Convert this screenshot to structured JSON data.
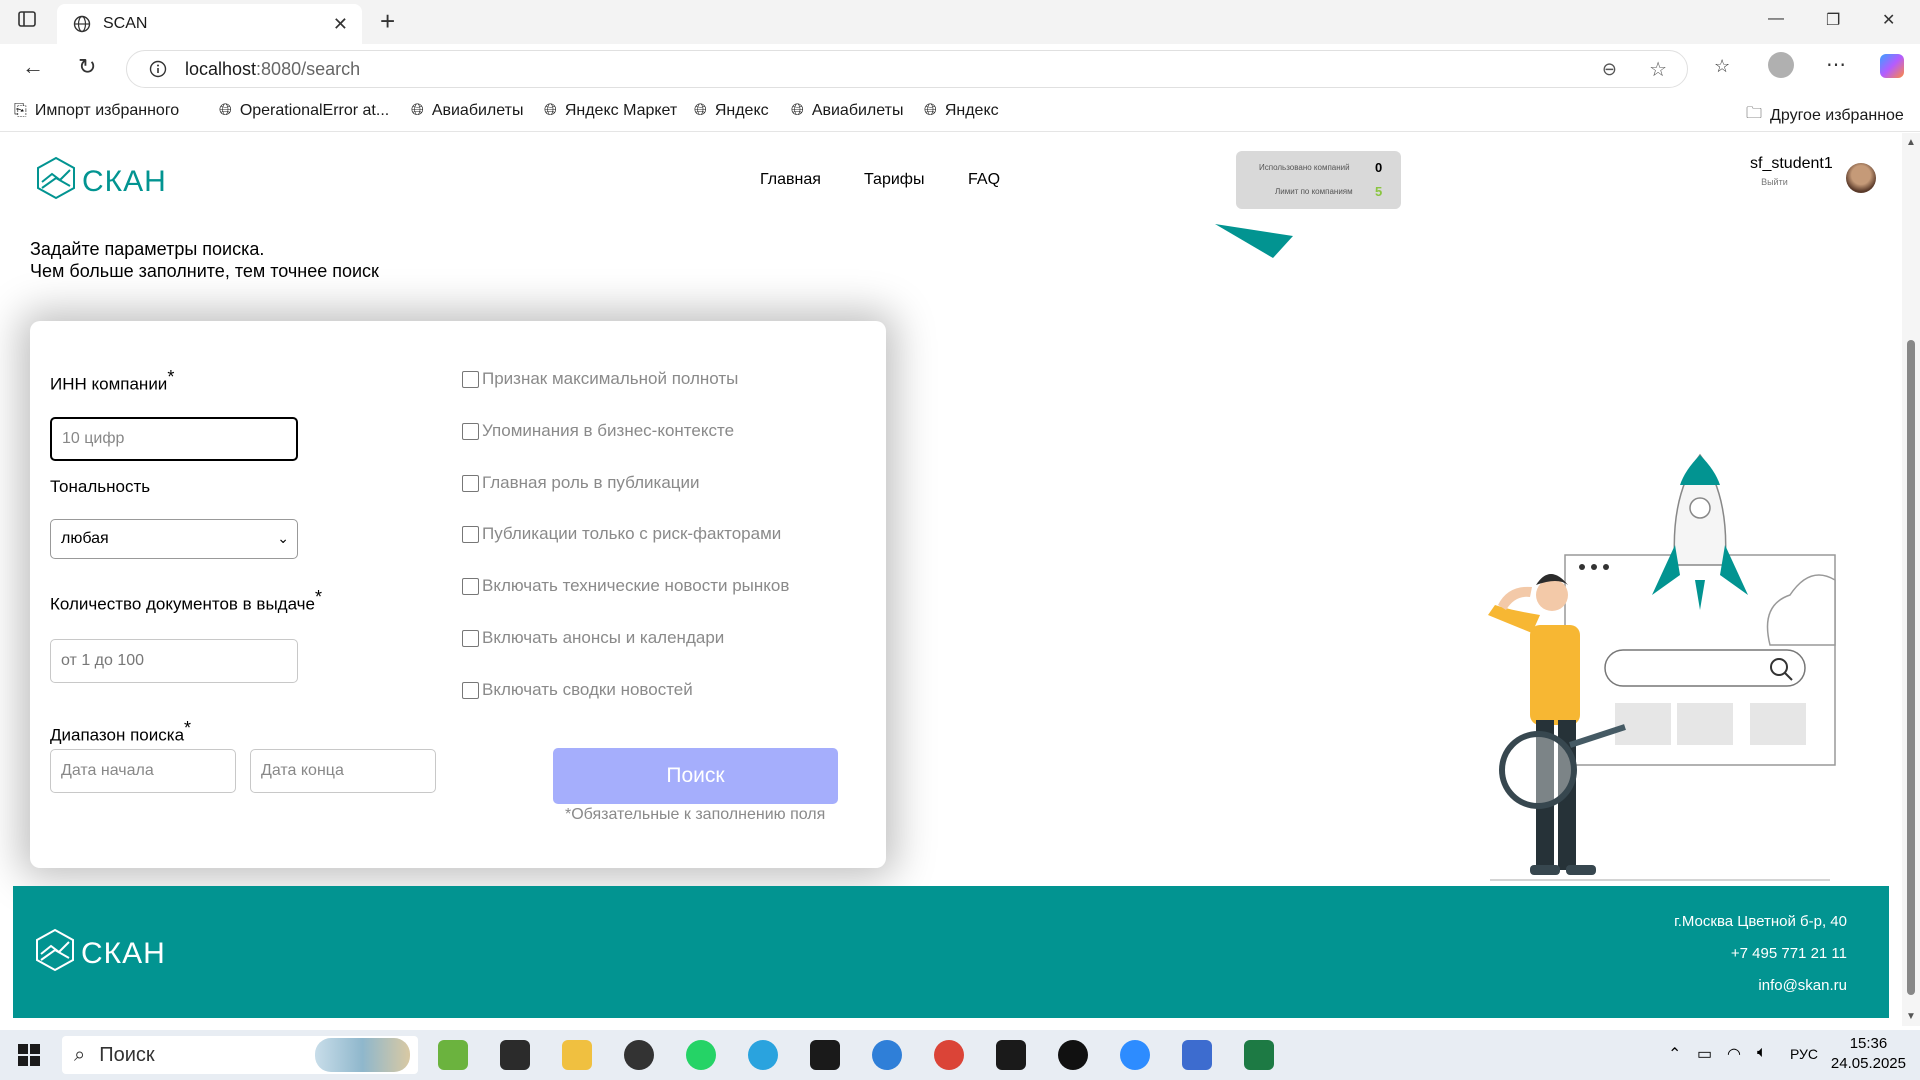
{
  "browser": {
    "tab_title": "SCAN",
    "url_host": "localhost",
    "url_path": ":8080/search",
    "bookmarks": [
      {
        "label": "Импорт избранного",
        "icon": "import-icon"
      },
      {
        "label": "OperationalError at...",
        "icon": "globe-icon"
      },
      {
        "label": "Авиабилеты",
        "icon": "globe-icon"
      },
      {
        "label": "Яндекс Маркет",
        "icon": "globe-icon"
      },
      {
        "label": "Яндекс",
        "icon": "globe-icon"
      },
      {
        "label": "Авиабилеты",
        "icon": "globe-icon"
      },
      {
        "label": "Яндекс",
        "icon": "globe-icon"
      }
    ],
    "other_bookmarks": "Другое избранное"
  },
  "header": {
    "logo_text": "СКАН",
    "nav": [
      "Главная",
      "Тарифы",
      "FAQ"
    ],
    "limits": {
      "used_label": "Использовано компаний",
      "used_value": "0",
      "limit_label": "Лимит по компаниям",
      "limit_value": "5"
    },
    "user": {
      "name": "sf_student1",
      "logout": "Выйти"
    }
  },
  "intro": {
    "line1": "Задайте параметры поиска.",
    "line2": "Чем больше заполните, тем точнее поиск"
  },
  "form": {
    "inn_label": "ИНН компании",
    "inn_placeholder": "10 цифр",
    "tone_label": "Тональность",
    "tone_value": "любая",
    "count_label": "Количество документов в выдаче",
    "count_placeholder": "от 1 до 100",
    "range_label": "Диапазон поиска",
    "date_start_placeholder": "Дата начала",
    "date_end_placeholder": "Дата конца",
    "required_mark": "*",
    "checkboxes": [
      "Признак максимальной полноты",
      "Упоминания в бизнес-контексте",
      "Главная роль в публикации",
      "Публикации только с риск-факторами",
      "Включать технические новости рынков",
      "Включать анонсы и календари",
      "Включать сводки новостей"
    ],
    "search_button": "Поиск",
    "required_note": "*Обязательные к заполнению поля"
  },
  "footer": {
    "logo_text": "СКАН",
    "address": "г.Москва Цветной б-р, 40",
    "phone": "+7 495 771 21 11",
    "email": "info@skan.ru"
  },
  "taskbar": {
    "search_label": "Поиск",
    "lang": "РУС",
    "time": "15:36",
    "date": "24.05.2025"
  },
  "colors": {
    "brand_teal": "#029491",
    "button_disabled": "#a5aefc",
    "limits_bg": "#d9d9d9",
    "limit_value_green": "#8ac540"
  }
}
